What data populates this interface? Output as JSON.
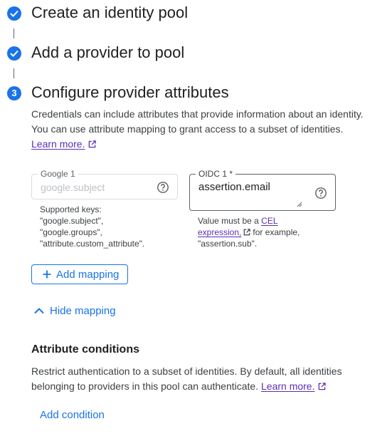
{
  "steps": [
    {
      "title": "Create an identity pool",
      "state": "complete",
      "icon": "check-icon"
    },
    {
      "title": "Add a provider to pool",
      "state": "complete",
      "icon": "check-icon"
    },
    {
      "title": "Configure provider attributes",
      "state": "active",
      "number": "3"
    }
  ],
  "description": {
    "line1": "Credentials can include attributes that provide information about an identity.",
    "line2": "You can use attribute mapping to grant access to a subset of identities.",
    "learn_more": "Learn more."
  },
  "mapping": {
    "google": {
      "label": "Google 1",
      "placeholder": "google.subject",
      "hint_lines": [
        "Supported keys:",
        "\"google.subject\",",
        "\"google.groups\",",
        "\"attribute.custom_attribute\"."
      ]
    },
    "oidc": {
      "label": "OIDC 1 *",
      "value": "assertion.email",
      "hint_prefix": "Value must be a",
      "hint_link_1": "CEL",
      "hint_link_2": "expression,",
      "hint_suffix": "for example,",
      "hint_example": "\"assertion.sub\"."
    },
    "add_mapping_label": "Add mapping",
    "hide_mapping_label": "Hide mapping"
  },
  "attribute_conditions": {
    "title": "Attribute conditions",
    "line1": "Restrict authentication to a subset of identities. By default, all identities",
    "line2_prefix": "belonging to providers in this pool can authenticate.",
    "learn_more": "Learn more.",
    "add_condition_label": "Add condition"
  },
  "colors": {
    "accent": "#1a73e8",
    "link_visited": "#5b2eb8",
    "text": "#202124"
  }
}
